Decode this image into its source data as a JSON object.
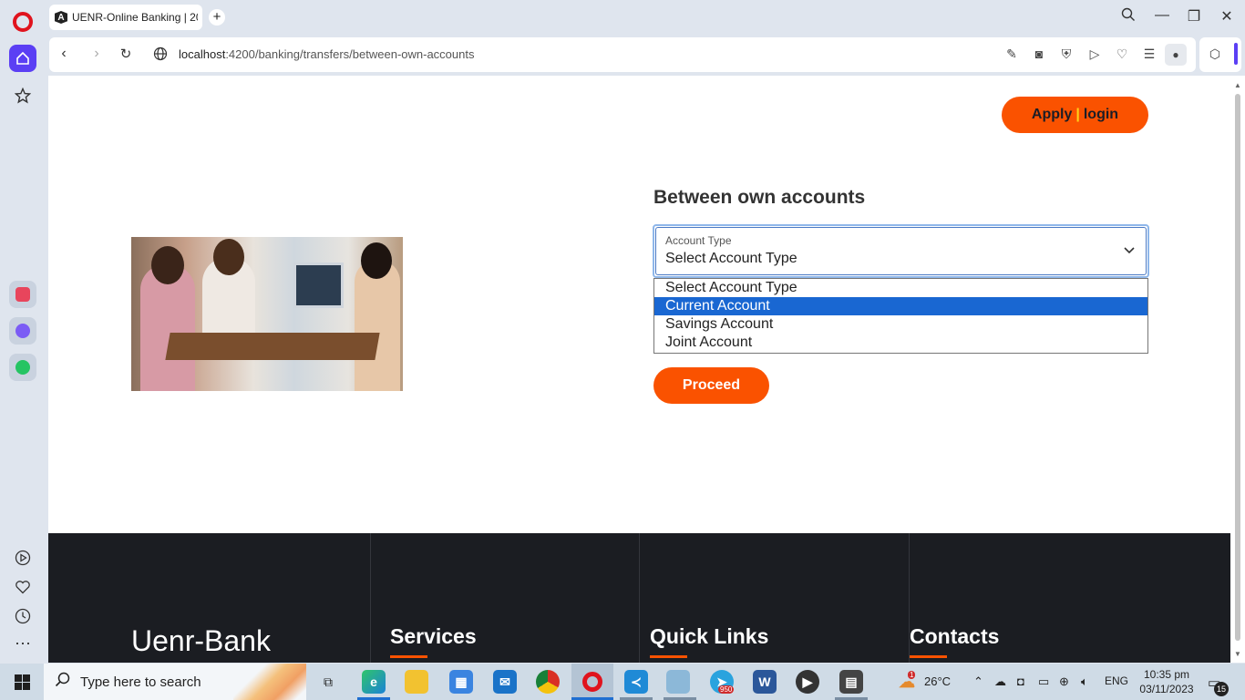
{
  "browser": {
    "tab_title": "UENR-Online Banking | 20",
    "tab_favicon": "A",
    "url_host": "localhost",
    "url_path": ":4200/banking/transfers/between-own-accounts"
  },
  "header": {
    "apply_label": "Apply",
    "separator": "|",
    "login_label": "login"
  },
  "form": {
    "title": "Between own accounts",
    "account_type_label": "Account Type",
    "selected_value": "Select Account Type",
    "options": [
      "Select Account Type",
      "Current Account",
      "Savings Account",
      "Joint Account"
    ],
    "highlighted_option": "Current Account",
    "proceed_label": "Proceed"
  },
  "footer": {
    "brand": "Uenr-Bank",
    "services_heading": "Services",
    "quick_links_heading": "Quick Links",
    "contacts_heading": "Contacts"
  },
  "taskbar": {
    "search_placeholder": "Type here to search",
    "temperature": "26°C",
    "language": "ENG",
    "time": "10:35 pm",
    "date": "03/11/2023",
    "telegram_badge": "950",
    "weather_badge": "1",
    "notification_count": "15"
  },
  "colors": {
    "accent_orange": "#fa5200",
    "footer_bg": "#1b1d22",
    "opera_purple": "#5b3ff4",
    "select_highlight": "#1967d2"
  }
}
